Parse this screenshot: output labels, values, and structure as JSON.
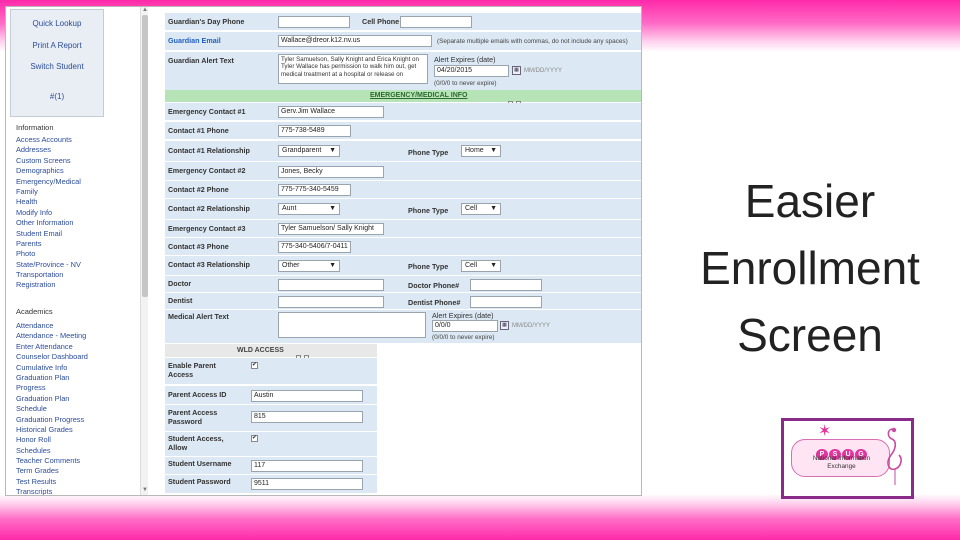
{
  "slide": {
    "title_lines": [
      "Easier",
      "Enrollment",
      "Screen"
    ]
  },
  "sidebar": {
    "tools": [
      "Quick Lookup",
      "Print A Report",
      "Switch Student",
      "#(1)"
    ],
    "info_header": "Information",
    "info_items": [
      "Access Accounts",
      "Addresses",
      "Custom Screens",
      "Demographics",
      "Emergency/Medical",
      "Family",
      "Health",
      "Modify Info",
      "Other Information",
      "Student Email",
      "Parents",
      "Photo",
      "State/Province - NV",
      "Transportation",
      "Registration"
    ],
    "academics_header": "Academics",
    "academics_items": [
      "Attendance",
      "Attendance - Meeting",
      "Enter Attendance",
      "Counselor Dashboard",
      "Cumulative Info",
      "Graduation Plan",
      "Progress",
      "Graduation Plan",
      "Schedule",
      "Graduation Progress",
      "Historical Grades",
      "Honor Roll",
      "Schedules",
      "Teacher Comments",
      "Term Grades",
      "Test Results",
      "Transcripts"
    ]
  },
  "form": {
    "guardian_day_phone": {
      "label": "Guardian's Day Phone",
      "value": ""
    },
    "cell_phone": {
      "label": "Cell Phone",
      "value": ""
    },
    "guardian_email": {
      "label": "Guardian Email",
      "value": "Wallace@dreor.k12.nv.us",
      "note": "(Separate multiple emails with commas, do not include any spaces)"
    },
    "guardian_alert_text": {
      "label": "Guardian Alert Text",
      "value": "Tyler Samuelson, Sally Knight and Erica Knight on Tyler Wallace has permission to walk him out, get medical treatment at a hospital or release on"
    },
    "guardian_alert_expires": {
      "label": "Alert Expires (date)",
      "value": "04/20/2015",
      "format": "MM/DD/YYYY",
      "note": "(0/0/0 to never expire)"
    },
    "emergency_bar": {
      "label": "EMERGENCY/MEDICAL INFO"
    },
    "emergency_contact_1": {
      "label": "Emergency Contact #1",
      "value": "Gerv.Jim Wallace"
    },
    "contact_1_phone": {
      "label": "Contact #1 Phone",
      "value": "775-738-5489"
    },
    "contact_1_relationship": {
      "label": "Contact #1 Relationship",
      "value": "Grandparent"
    },
    "contact_1_phone_type": {
      "label": "Phone Type",
      "value": "Home"
    },
    "emergency_contact_2": {
      "label": "Emergency Contact #2",
      "value": "Jones, Becky"
    },
    "contact_2_phone": {
      "label": "Contact #2 Phone",
      "value": "775-775-340-5459"
    },
    "contact_2_relationship": {
      "label": "Contact #2 Relationship",
      "value": "Aunt"
    },
    "contact_2_phone_type": {
      "label": "Phone Type",
      "value": "Cell"
    },
    "emergency_contact_3": {
      "label": "Emergency Contact #3",
      "value": "Tyler Samuelson/ Sally Knight"
    },
    "contact_3_phone": {
      "label": "Contact #3 Phone",
      "value": "775-340-5406/7-0411"
    },
    "contact_3_relationship": {
      "label": "Contact #3 Relationship",
      "value": "Other"
    },
    "contact_3_phone_type": {
      "label": "Phone Type",
      "value": "Cell"
    },
    "doctor": {
      "label": "Doctor",
      "value": ""
    },
    "doctor_phone": {
      "label": "Doctor Phone#",
      "value": ""
    },
    "dentist": {
      "label": "Dentist",
      "value": ""
    },
    "dentist_phone": {
      "label": "Dentist Phone#",
      "value": ""
    },
    "medical_alert_text": {
      "label": "Medical Alert Text",
      "value": ""
    },
    "medical_alert_expires": {
      "label": "Alert Expires (date)",
      "value": "0/0/0",
      "format": "MM/DD/YYYY",
      "note": "(0/0/0 to never expire)"
    },
    "wld_access": {
      "label": "WLD ACCESS"
    },
    "enable_parent_access": {
      "label": "Enable Parent Access",
      "checked": true
    },
    "parent_access_id": {
      "label": "Parent Access ID",
      "value": "Austin"
    },
    "parent_access_password": {
      "label": "Parent Access Password",
      "value": "815"
    },
    "student_access_allow": {
      "label": "Student Access, Allow",
      "checked": true
    },
    "student_username": {
      "label": "Student Username",
      "value": "117"
    },
    "student_password": {
      "label": "Student Password",
      "value": "9511"
    }
  },
  "logo": {
    "letters": [
      "P",
      "S",
      "U",
      "G"
    ],
    "line1": "National Information",
    "line2": "Exchange"
  },
  "colors": {
    "band": "#ff2aa9",
    "row": "#dce8f3",
    "green": "#b7e4b7",
    "logo_border": "#8a2b8a"
  }
}
